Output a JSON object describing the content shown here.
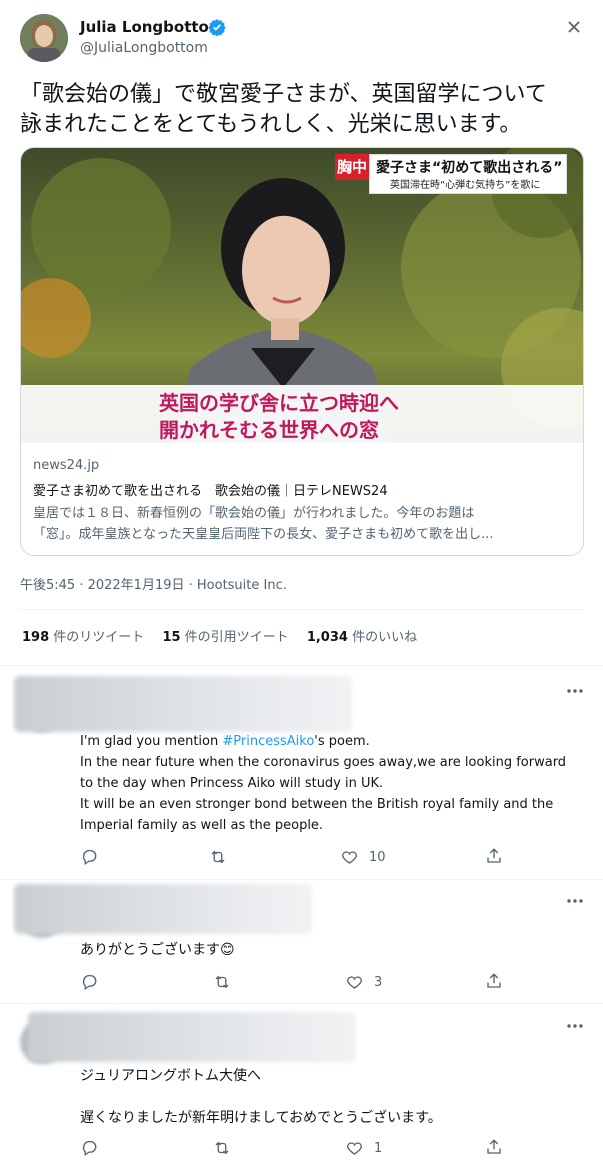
{
  "author": {
    "name": "Julia Longbottom",
    "handle": "@JuliaLongbottom"
  },
  "tweet": {
    "text_line1": "「歌会始の儀」で敬宮愛子さまが、英国留学について",
    "text_line2": "詠まれたことをとてもうれしく、光栄に思います。",
    "meta": "午後5:45 · 2022年1月19日 · Hootsuite Inc."
  },
  "card": {
    "banner_tag": "胸中",
    "banner_title": "愛子さま“初めて歌出される”",
    "banner_sub": "英国滞在時“心弾む気持ち”を歌に",
    "caption_line1": "英国の学び舎に立つ時迎へ",
    "caption_line2": "開かれそむる世界への窓",
    "domain": "news24.jp",
    "title": "愛子さま初めて歌を出される　歌会始の儀｜日テレNEWS24",
    "desc_line1": "皇居では１８日、新春恒例の「歌会始の儀」が行われました。今年のお題は",
    "desc_line2": "「窓」。成年皇族となった天皇皇后両陛下の長女、愛子さまも初めて歌を出し..."
  },
  "stats": {
    "retweets_count": "198",
    "retweets_label": "件のリツイート",
    "quotes_count": "15",
    "quotes_label": "件の引用ツイート",
    "likes_count": "1,034",
    "likes_label": "件のいいね"
  },
  "replies": [
    {
      "text_pre": "I'm glad you mention ",
      "hashtag": "#PrincessAiko",
      "text_post": "'s poem.",
      "line2": "In the near future when the coronavirus  goes away,we are looking forward",
      "line3": "to the day when Princess Aiko will study in UK.",
      "line4": "It will be an even stronger bond between the British royal family and the",
      "line5": "Imperial family as well as the people.",
      "likes": "10"
    },
    {
      "line1": "ありがとうございます",
      "emoji": "😊",
      "likes": "3"
    },
    {
      "line1": "ジュリアロングボトム大使へ",
      "line2": "遅くなりましたが新年明けましておめでとうございます。",
      "likes": "1"
    }
  ],
  "colors": {
    "accent": "#1d9bf0",
    "text": "#0f1419",
    "muted": "#536471",
    "divider": "#eff3f4",
    "caption_red": "#c2185b"
  },
  "icons": [
    "verified-badge-icon",
    "more-icon",
    "reply-icon",
    "retweet-icon",
    "like-icon",
    "share-icon"
  ]
}
